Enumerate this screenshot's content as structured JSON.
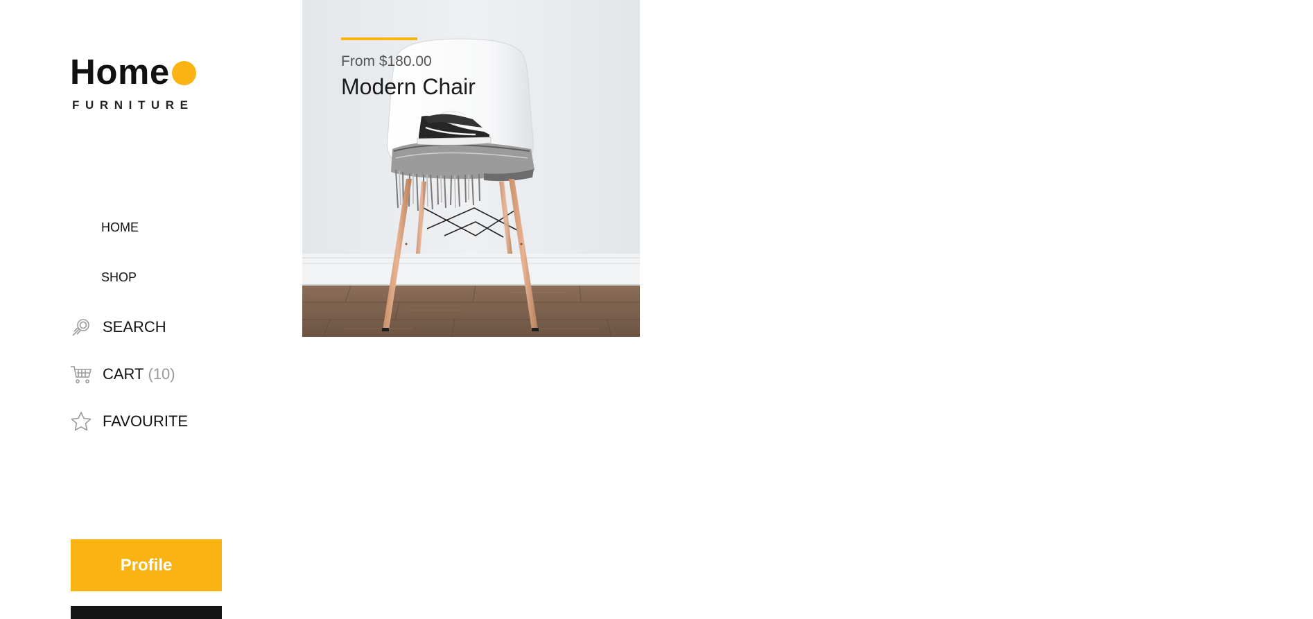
{
  "brand": {
    "name": "Home",
    "subtitle": "FURNITURE",
    "accent_color": "#f9b413"
  },
  "nav": {
    "home": "HOME",
    "shop": "SHOP",
    "search": {
      "label": "SEARCH",
      "icon": "search-icon"
    },
    "cart": {
      "label": "CART",
      "count": "(10)",
      "icon": "cart-icon"
    },
    "favourite": {
      "label": "FAVOURITE",
      "icon": "star-icon"
    }
  },
  "buttons": {
    "profile": "Profile"
  },
  "product": {
    "price": "From $180.00",
    "title": "Modern Chair",
    "image_subject": "chair-with-sneakers"
  }
}
